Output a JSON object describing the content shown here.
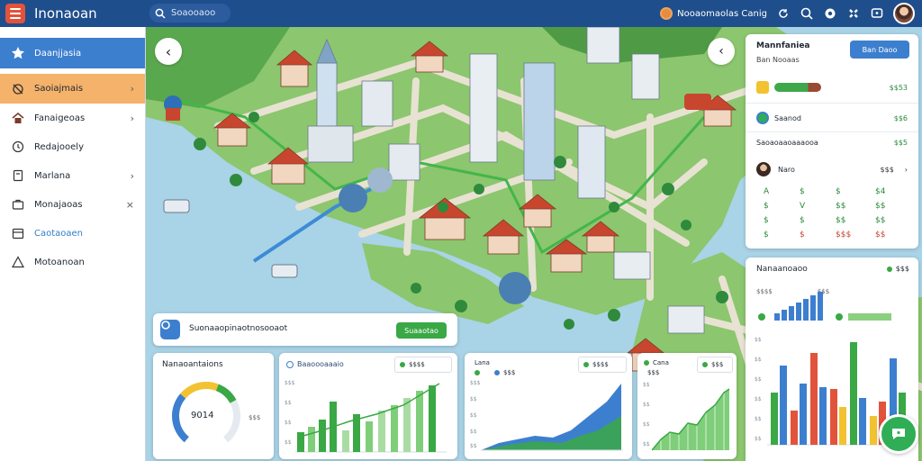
{
  "app": {
    "title": "Inonaoan"
  },
  "search": {
    "placeholder": "Soaooaoo"
  },
  "header": {
    "location_label": "Nooaomaolas Canig"
  },
  "sidebar": {
    "items": [
      {
        "label": "Daanjjasia"
      },
      {
        "label": "Saoiajmais"
      },
      {
        "label": "Fanaigeoas"
      },
      {
        "label": "Redajooely"
      },
      {
        "label": "Marlana"
      },
      {
        "label": "Monajaoas"
      },
      {
        "label": "Caotaoaen"
      },
      {
        "label": "Motoanoan"
      }
    ]
  },
  "info_panel": {
    "title": "Mannfaniea",
    "subtitle": "Ban Nooaas",
    "button_label": "Ban Daoo",
    "rows": [
      {
        "value": "$$53"
      },
      {
        "label": "Saanod",
        "value": "$$6"
      },
      {
        "label": "Saoaoaaoaaaooa",
        "value": "$$5"
      },
      {
        "label": "Naro",
        "value": "$$$"
      }
    ],
    "grid": [
      [
        "A",
        "$",
        "$",
        "$4"
      ],
      [
        "$",
        "V",
        "$$",
        "$$"
      ],
      [
        "$",
        "$",
        "$$",
        "$$"
      ],
      [
        "$",
        "$",
        "$$$",
        "$$"
      ]
    ]
  },
  "chart_panel": {
    "title": "Nanaanoaoo",
    "legend_value": "$$$",
    "legend_a": "$$$$",
    "legend_b": "$$$",
    "left_ticks": [
      "$$",
      "$$",
      "$$",
      "$$",
      "$$",
      "$$"
    ]
  },
  "banner": {
    "text": "Suonaaopinaotnosooaot",
    "button_label": "Suaaotao"
  },
  "card_gauge": {
    "title": "Nanaoantaions",
    "value": "9014",
    "side_label": "$$$",
    "level": 0.72
  },
  "card_bars": {
    "title": "Baaoooaaaio",
    "legend": "$$$$",
    "ticks": [
      "$$$",
      "$$",
      "$$",
      "$$"
    ]
  },
  "card_area1": {
    "legend_a": "Lana",
    "legend_b": "$$$",
    "value": "$$$$",
    "ticks": [
      "$$$",
      "$$",
      "$$",
      "$$",
      "$$"
    ]
  },
  "card_area2": {
    "legend_a": "Cana",
    "legend_b": "$$$",
    "value": "$$$",
    "ticks": [
      "$$",
      "$$",
      "$$",
      "$$"
    ]
  },
  "colors": {
    "topbar": "#1f4e8c",
    "accent_blue": "#3d7fcf",
    "accent_orange": "#f5b26b",
    "accent_green": "#39a845",
    "water": "#a9d3e6"
  },
  "icons": [
    "hamburger-menu-icon",
    "search-icon",
    "location-pin-icon",
    "settings-icon",
    "star-icon",
    "home-icon",
    "gear-icon",
    "chat-icon"
  ]
}
